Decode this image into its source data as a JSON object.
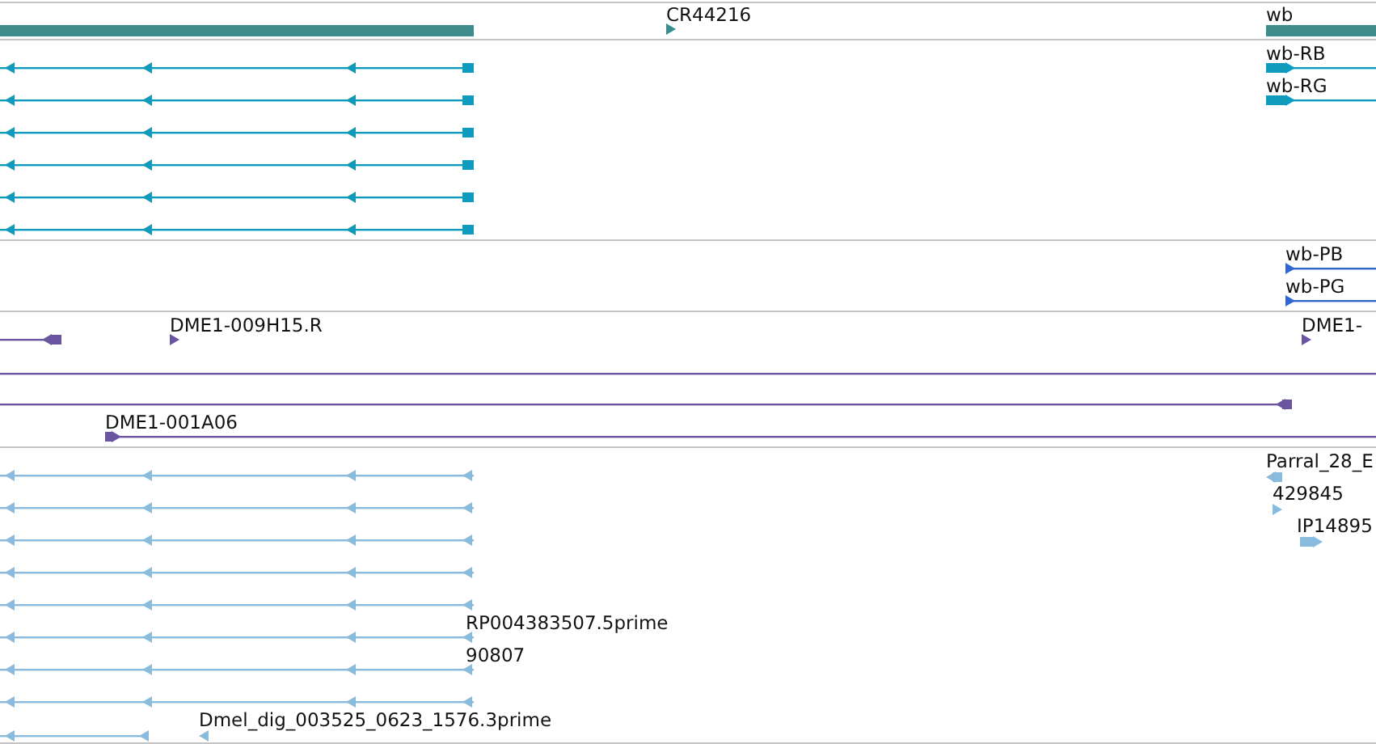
{
  "tracks": [
    {
      "color": "#3d8b8b",
      "labels": [
        "CR44216",
        "wb"
      ]
    },
    {
      "color": "#0e9bbd",
      "labels": [
        "wb-RB",
        "wb-RG"
      ]
    },
    {
      "color": "#3366cc",
      "labels": [
        "wb-PB",
        "wb-PG"
      ]
    },
    {
      "color": "#6a55a0",
      "labels": [
        "DME1-009H15.R",
        "DME1-",
        "DME1-001A06"
      ]
    },
    {
      "color": "#88bbdd",
      "labels": [
        "Parral_28_E",
        "429845",
        "IP14895",
        "RP004383507.5prime",
        "90807",
        "Dmel_dig_003525_0623_1576.3prime"
      ]
    }
  ]
}
